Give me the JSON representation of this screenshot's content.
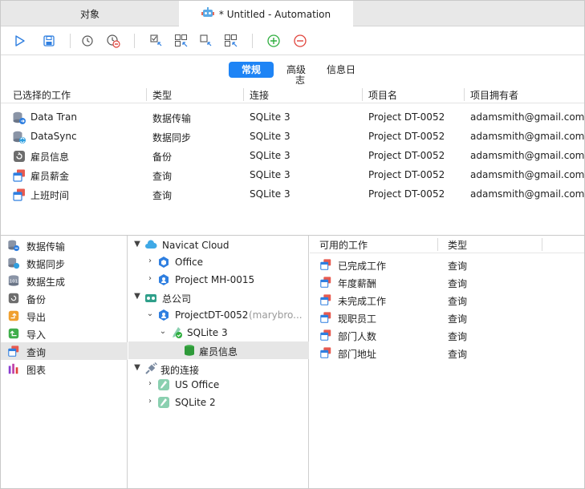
{
  "tabs": {
    "objects_label": "对象",
    "automation_label": "* Untitled - Automation"
  },
  "toolbar": {
    "buttons": [
      "play-icon",
      "save-icon",
      "clock-icon",
      "schedule-delete-icon",
      "select-icon",
      "select-all-icon",
      "deselect-icon",
      "deselect-all-icon",
      "add-icon",
      "remove-icon"
    ]
  },
  "segments": {
    "general": "常规",
    "advanced": "高级",
    "advanced_wrap": "志",
    "log": "信息日"
  },
  "jobs_table": {
    "headers": [
      "已选择的工作",
      "类型",
      "连接",
      "项目名",
      "项目拥有者"
    ],
    "rows": [
      {
        "name": "Data Tran",
        "type": "数据传输",
        "conn": "SQLite 3",
        "project": "Project DT-0052",
        "owner": "adamsmith@gmail.com",
        "icon": "data-transfer-icon"
      },
      {
        "name": "DataSync",
        "type": "数据同步",
        "conn": "SQLite 3",
        "project": "Project DT-0052",
        "owner": "adamsmith@gmail.com",
        "icon": "data-sync-icon"
      },
      {
        "name": "雇员信息",
        "type": "备份",
        "conn": "SQLite 3",
        "project": "Project DT-0052",
        "owner": "adamsmith@gmail.com",
        "icon": "backup-icon"
      },
      {
        "name": "雇员薪金",
        "type": "查询",
        "conn": "SQLite 3",
        "project": "Project DT-0052",
        "owner": "adamsmith@gmail.com",
        "icon": "query-icon"
      },
      {
        "name": "上班时间",
        "type": "查询",
        "conn": "SQLite 3",
        "project": "Project DT-0052",
        "owner": "adamsmith@gmail.com",
        "icon": "query-icon"
      }
    ]
  },
  "categories": [
    {
      "label": "数据传输",
      "icon": "data-transfer-icon"
    },
    {
      "label": "数据同步",
      "icon": "data-sync-icon"
    },
    {
      "label": "数据生成",
      "icon": "data-generation-icon"
    },
    {
      "label": "备份",
      "icon": "backup-icon"
    },
    {
      "label": "导出",
      "icon": "export-icon"
    },
    {
      "label": "导入",
      "icon": "import-icon"
    },
    {
      "label": "查询",
      "icon": "query-icon"
    },
    {
      "label": "图表",
      "icon": "chart-icon"
    }
  ],
  "tree": {
    "navicat_cloud": "Navicat Cloud",
    "office": "Office",
    "project_mh": "Project MH-0015",
    "head_office": "总公司",
    "project_dt": "ProjectDT-0052",
    "project_dt_owner": "(marybro...",
    "sqlite3": "SQLite 3",
    "employee_info": "雇员信息",
    "my_connections": "我的连接",
    "us_office": "US Office",
    "sqlite2": "SQLite 2"
  },
  "available": {
    "headers": [
      "可用的工作",
      "类型"
    ],
    "rows": [
      {
        "name": "已完成工作",
        "type": "查询"
      },
      {
        "name": "年度薪酬",
        "type": "查询"
      },
      {
        "name": "未完成工作",
        "type": "查询"
      },
      {
        "name": "现职员工",
        "type": "查询"
      },
      {
        "name": "部门人数",
        "type": "查询"
      },
      {
        "name": "部门地址",
        "type": "查询"
      }
    ]
  },
  "colors": {
    "accent": "#1e84f5",
    "selection": "#e6e6e6",
    "add_green": "#2fae3f",
    "remove_red": "#e0433b"
  }
}
